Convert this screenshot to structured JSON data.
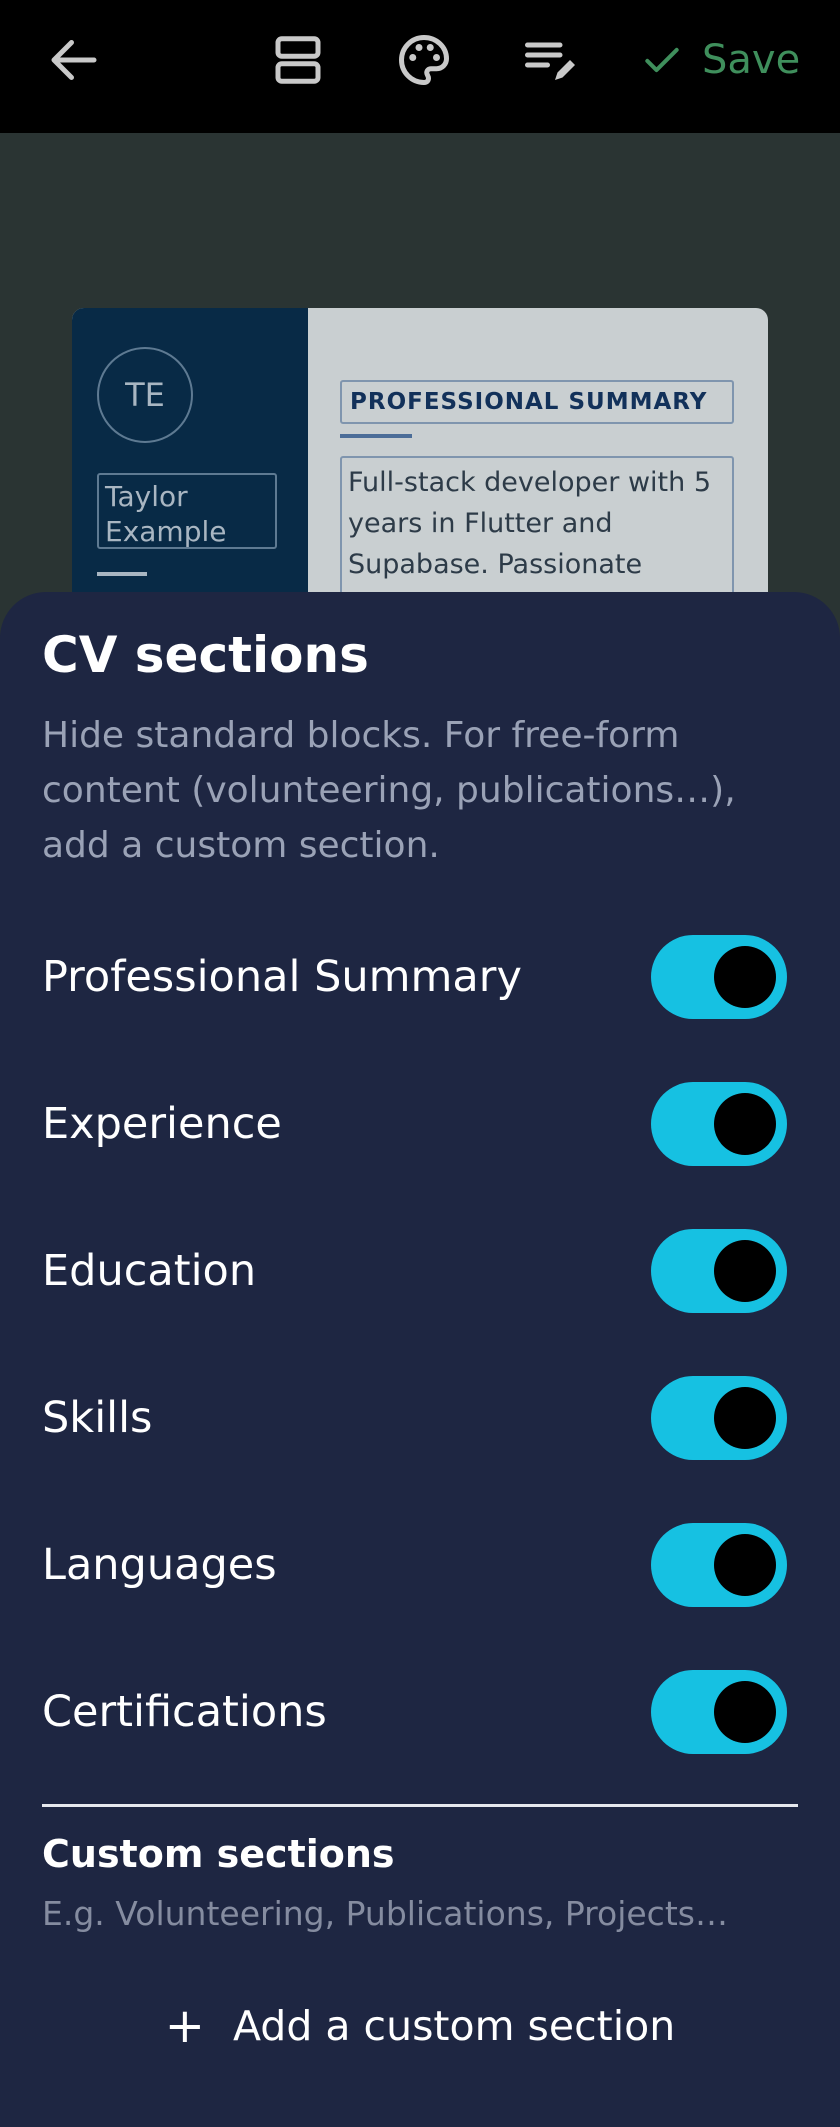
{
  "toolbar": {
    "save_label": "Save",
    "icons": [
      "back-arrow-icon",
      "sections-icon",
      "palette-icon",
      "edit-text-icon",
      "check-icon"
    ]
  },
  "preview": {
    "initials": "TE",
    "name_line1": "Taylor",
    "name_line2": "Example",
    "section_title": "PROFESSIONAL SUMMARY",
    "summary_lines": [
      "Full-stack developer with 5",
      "years in Flutter and",
      "Supabase. Passionate about"
    ]
  },
  "sheet": {
    "title": "CV sections",
    "description": "Hide standard blocks. For free-form content (volunteering, publications…), add a custom section.",
    "sections": [
      {
        "label": "Professional Summary",
        "enabled": true
      },
      {
        "label": "Experience",
        "enabled": true
      },
      {
        "label": "Education",
        "enabled": true
      },
      {
        "label": "Skills",
        "enabled": true
      },
      {
        "label": "Languages",
        "enabled": true
      },
      {
        "label": "Certifications",
        "enabled": true
      }
    ],
    "custom_title": "Custom sections",
    "custom_hint": "E.g. Volunteering, Publications, Projects…",
    "add_label": "Add a custom section"
  },
  "colors": {
    "toggle_on": "#16c1e2",
    "sheet_bg": "#1e2642",
    "save_green": "#3f8f5c"
  }
}
